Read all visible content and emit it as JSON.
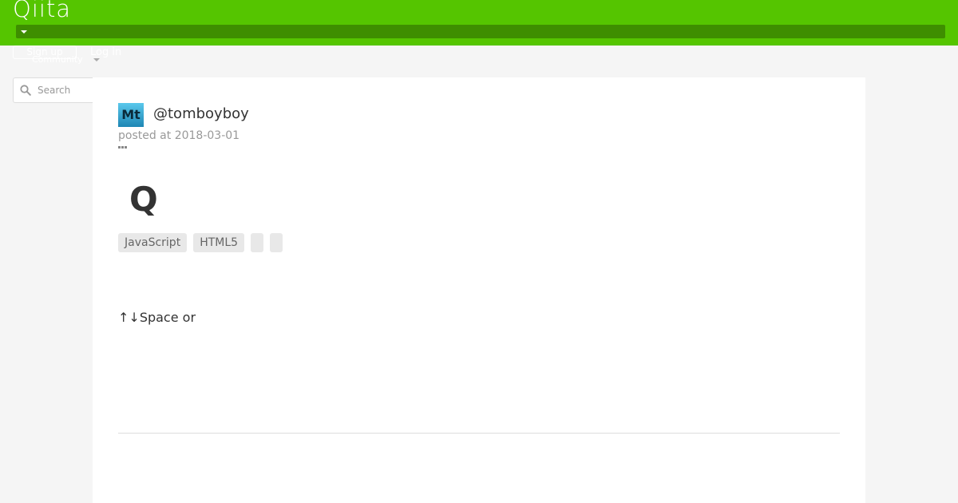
{
  "header": {
    "logo_text": "Qiita",
    "brand_color": "#55c500",
    "community_bar_color": "#3e8e00"
  },
  "auth": {
    "signup_label": "Sign up",
    "login_label": "Log in"
  },
  "community": {
    "label": "Community"
  },
  "search": {
    "placeholder": "Search",
    "value": ""
  },
  "article": {
    "avatar_text": "Mt",
    "username": "@tomboyboy",
    "posted": "posted at 2018-03-01",
    "title": "Q",
    "tags": [
      "JavaScript",
      "HTML5",
      "",
      ""
    ],
    "body": "↑↓Space or"
  },
  "icons": {
    "search": "search-icon",
    "caret": "chevron-down-icon",
    "more": "more-dots-icon"
  }
}
